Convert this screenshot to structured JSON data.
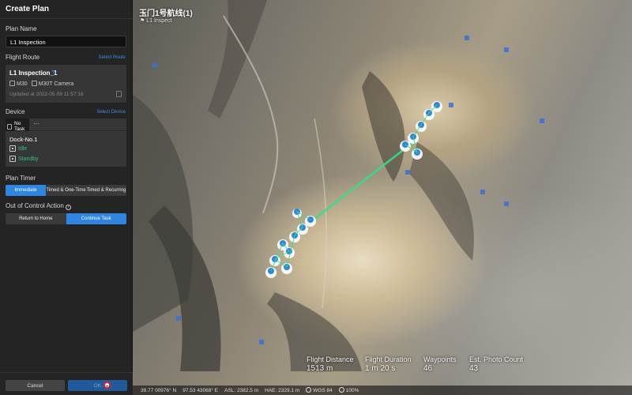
{
  "panel": {
    "title": "Create Plan",
    "plan_name_label": "Plan Name",
    "plan_name_value": "L1 Inspection",
    "flight_route_label": "Flight Route",
    "select_route_link": "Select Route",
    "route": {
      "name": "L1 Inspection_1",
      "aircraft": "M30",
      "camera": "M30T Camera",
      "updated": "Updated at 2022-05-09 11:57:16"
    },
    "device_label": "Device",
    "select_device_link": "Select Device",
    "device": {
      "tab_label": "No Task",
      "more": "···",
      "dock_name": "Dock-No.1",
      "dock_status": "Idle",
      "aircraft_status": "Standby",
      "status_color": "#2ec27e"
    },
    "plan_timer_label": "Plan Timer",
    "timer_options": [
      "Immediate",
      "Timed & One-Time",
      "Timed & Recurring"
    ],
    "timer_selected": "Immediate",
    "out_of_control_label": "Out of Control Action",
    "out_of_control_options": [
      "Return to Home",
      "Continue Task"
    ],
    "out_of_control_selected": "Continue Task",
    "cancel_label": "Cancel",
    "ok_label": "OK",
    "accent_color": "#2f86e0"
  },
  "map": {
    "title": "玉门1号航线(1)",
    "subtitle": "L1 Inspect",
    "stats": {
      "distance_label": "Flight Distance",
      "distance_value": "1513 m",
      "duration_label": "Flight Duration",
      "duration_value": "1 m 20 s",
      "waypoints_label": "Waypoints",
      "waypoints_value": "46",
      "photo_label": "Est. Photo Count",
      "photo_value": "43"
    },
    "statusbar": {
      "lat": "39.77 00976° N",
      "lon": "97.53 43068° E",
      "asl": "ASL: 2382.5 m",
      "hae": "HAE: 2329.1 m",
      "datum": "WGS 84",
      "zoom": "100%"
    },
    "route_color": "#2ee28a",
    "waypoint_color": "#2f86e0"
  }
}
